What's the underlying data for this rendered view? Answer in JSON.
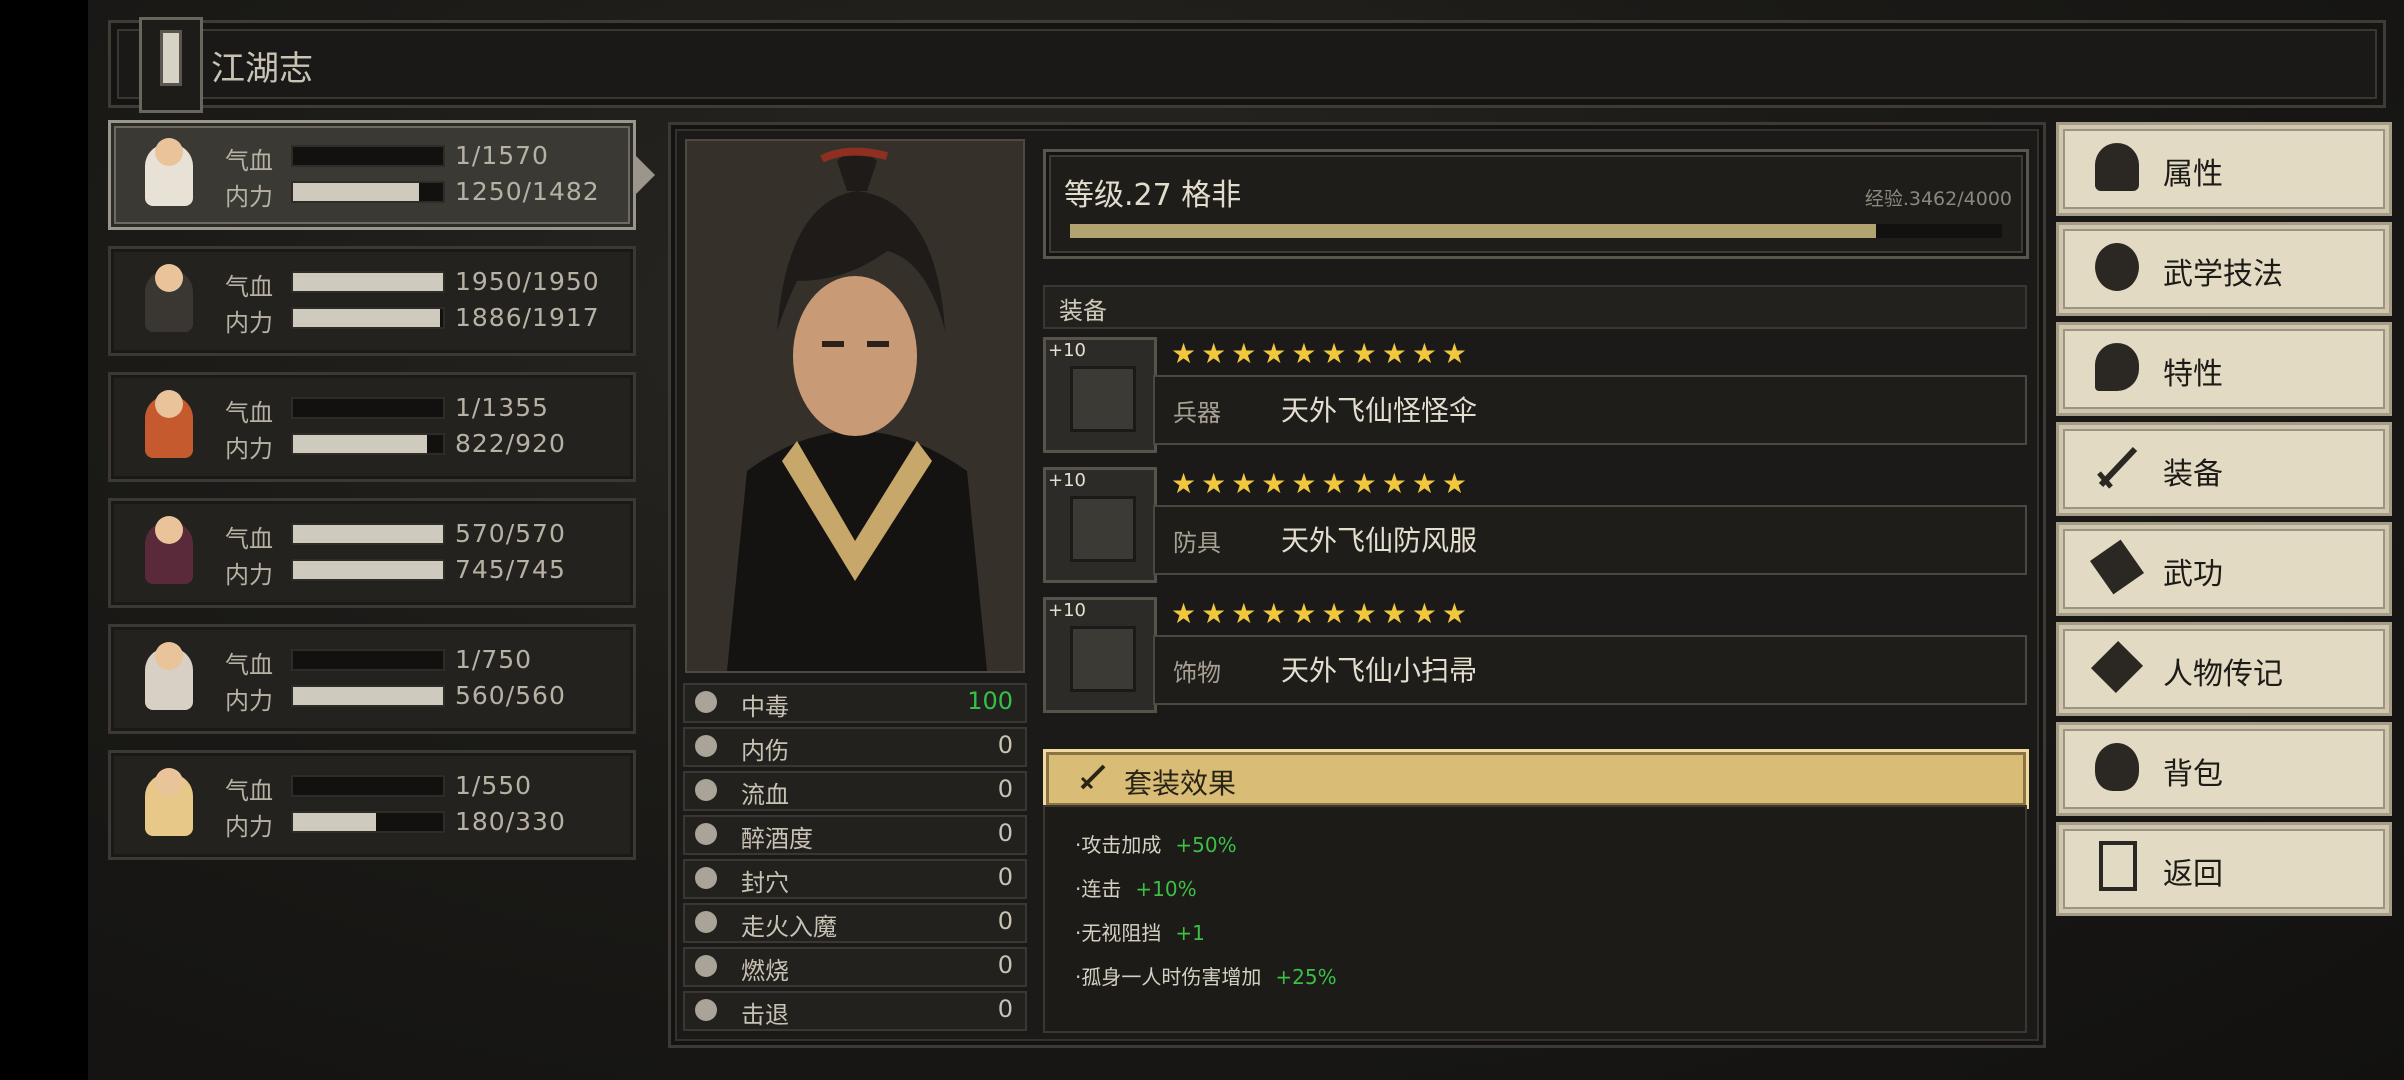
{
  "title": "江湖志",
  "party": [
    {
      "hp_label": "气血",
      "hp": "1/1570",
      "hp_frac": 0.0,
      "mp_label": "内力",
      "mp": "1250/1482",
      "mp_frac": 0.84,
      "colors": {
        "body": "#e8e2d6"
      }
    },
    {
      "hp_label": "气血",
      "hp": "1950/1950",
      "hp_frac": 1.0,
      "mp_label": "内力",
      "mp": "1886/1917",
      "mp_frac": 0.98,
      "colors": {
        "body": "#3a3733"
      }
    },
    {
      "hp_label": "气血",
      "hp": "1/1355",
      "hp_frac": 0.0,
      "mp_label": "内力",
      "mp": "822/920",
      "mp_frac": 0.89,
      "colors": {
        "body": "#c45a2e"
      }
    },
    {
      "hp_label": "气血",
      "hp": "570/570",
      "hp_frac": 1.0,
      "mp_label": "内力",
      "mp": "745/745",
      "mp_frac": 1.0,
      "colors": {
        "body": "#5b2a3a"
      }
    },
    {
      "hp_label": "气血",
      "hp": "1/750",
      "hp_frac": 0.0,
      "mp_label": "内力",
      "mp": "560/560",
      "mp_frac": 1.0,
      "colors": {
        "body": "#d8d0c4"
      }
    },
    {
      "hp_label": "气血",
      "hp": "1/550",
      "hp_frac": 0.0,
      "mp_label": "内力",
      "mp": "180/330",
      "mp_frac": 0.55,
      "colors": {
        "body": "#e7c889"
      }
    }
  ],
  "character": {
    "level_text": "等级.27 格非",
    "exp_text": "经验.3462/4000",
    "exp_frac": 0.8655
  },
  "statuses": [
    {
      "label": "中毒",
      "value": "100",
      "icon": "skull-icon",
      "accent": "#35c04a"
    },
    {
      "label": "内伤",
      "value": "0",
      "icon": "broken-heart-icon"
    },
    {
      "label": "流血",
      "value": "0",
      "icon": "blood-icon"
    },
    {
      "label": "醉酒度",
      "value": "0",
      "icon": "drunk-face-icon"
    },
    {
      "label": "封穴",
      "value": "0",
      "icon": "acupoint-icon"
    },
    {
      "label": "走火入魔",
      "value": "0",
      "icon": "demon-face-icon"
    },
    {
      "label": "燃烧",
      "value": "0",
      "icon": "fire-icon"
    },
    {
      "label": "击退",
      "value": "0",
      "icon": "boot-icon"
    }
  ],
  "equipment": {
    "header": "装备",
    "stars": "★★★★★★★★★★",
    "items": [
      {
        "plus": "+10",
        "type": "兵器",
        "name": "天外飞仙怪怪伞",
        "icon": "umbrella-icon"
      },
      {
        "plus": "+10",
        "type": "防具",
        "name": "天外飞仙防风服",
        "icon": "robe-icon"
      },
      {
        "plus": "+10",
        "type": "饰物",
        "name": "天外飞仙小扫帚",
        "icon": "broom-icon"
      }
    ]
  },
  "set_bonus": {
    "header": "套装效果",
    "lines": [
      {
        "label": "·攻击加成",
        "value": "+50%"
      },
      {
        "label": "·连击",
        "value": "+10%"
      },
      {
        "label": "·无视阻挡",
        "value": "+1"
      },
      {
        "label": "·孤身一人时伤害增加",
        "value": "+25%"
      }
    ]
  },
  "menu": [
    {
      "label": "属性",
      "icon": "person-icon"
    },
    {
      "label": "武学技法",
      "icon": "martial-arts-icon"
    },
    {
      "label": "特性",
      "icon": "trait-icon"
    },
    {
      "label": "装备",
      "icon": "sword-icon"
    },
    {
      "label": "武功",
      "icon": "book-icon"
    },
    {
      "label": "人物传记",
      "icon": "scroll-icon"
    },
    {
      "label": "背包",
      "icon": "bag-icon"
    },
    {
      "label": "返回",
      "icon": "door-icon"
    }
  ]
}
